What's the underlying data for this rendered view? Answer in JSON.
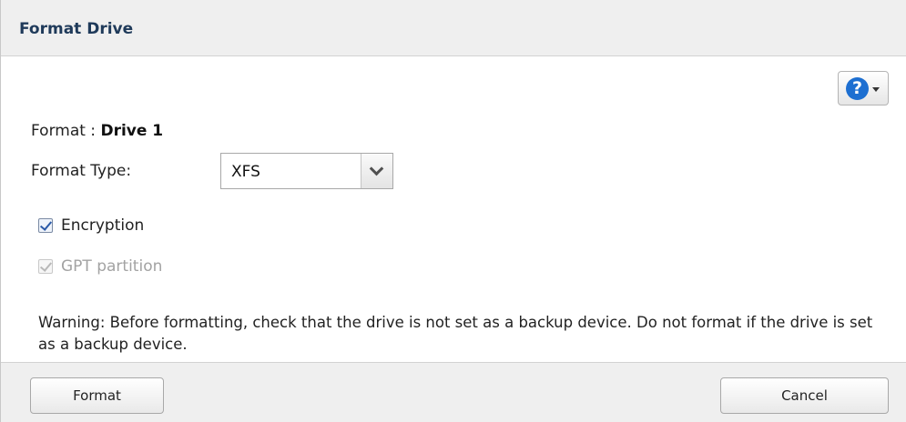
{
  "dialog": {
    "title": "Format Drive"
  },
  "help": {
    "icon": "help-icon",
    "glyph": "?",
    "accent": "#1d6fd1"
  },
  "format": {
    "label": "Format : ",
    "drive": "Drive 1"
  },
  "format_type": {
    "label": "Format Type:",
    "selected": "XFS"
  },
  "options": {
    "encryption": {
      "label": "Encryption",
      "checked": true,
      "disabled": false
    },
    "gpt": {
      "label": "GPT partition",
      "checked": true,
      "disabled": true
    }
  },
  "warning": {
    "text": "Warning: Before formatting, check that the drive is not set as a backup device. Do not format if the drive is set as a backup device."
  },
  "footer": {
    "format_button": "Format",
    "cancel_button": "Cancel"
  }
}
